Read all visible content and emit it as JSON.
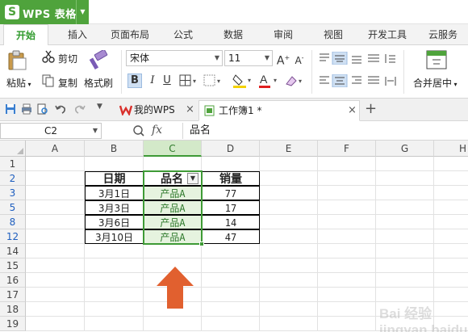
{
  "app": {
    "title": "WPS 表格",
    "logo_letter": "S"
  },
  "menu": {
    "tabs": [
      "开始",
      "插入",
      "页面布局",
      "公式",
      "数据",
      "审阅",
      "视图",
      "开发工具",
      "云服务"
    ],
    "active": 0
  },
  "ribbon": {
    "cut": "剪切",
    "paste": "粘贴",
    "copy": "复制",
    "format_painter": "格式刷",
    "font_name": "宋体",
    "font_size": "11",
    "bold": "B",
    "italic": "I",
    "underline": "U",
    "merge_center": "合并居中"
  },
  "doc_tabs": [
    {
      "label": "我的WPS"
    },
    {
      "label": "工作簿1 *"
    }
  ],
  "formula_bar": {
    "cell_ref": "C2",
    "fx": "fx",
    "content": "品名"
  },
  "grid": {
    "columns": [
      "A",
      "B",
      "C",
      "D",
      "E",
      "F",
      "G",
      "H"
    ],
    "active_column": "C",
    "rows": [
      "1",
      "2",
      "3",
      "5",
      "8",
      "12",
      "14",
      "15",
      "16",
      "17",
      "18",
      "19"
    ],
    "table": {
      "headers": [
        "日期",
        "品名",
        "销量"
      ],
      "rows": [
        [
          "3月1日",
          "产品A",
          "77"
        ],
        [
          "3月3日",
          "产品A",
          "17"
        ],
        [
          "3月6日",
          "产品A",
          "14"
        ],
        [
          "3月10日",
          "产品A",
          "47"
        ]
      ]
    }
  },
  "colors": {
    "accent": "#4fa33c",
    "selection": "#3e9a36",
    "arrow": "#e1602f",
    "filtered_row": "#1f5fbf"
  },
  "watermark": "Bai 经验 jingyan.baidu.com"
}
